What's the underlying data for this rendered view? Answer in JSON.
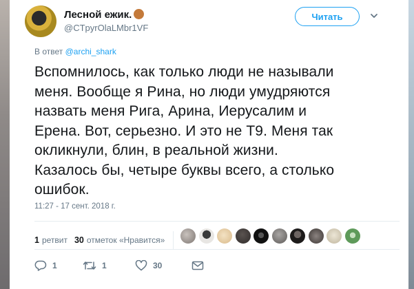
{
  "user": {
    "name": "Лесной ежик.",
    "name_emoji": "hedgehog-emoji",
    "handle": "@CTpyrOlaLMbr1VF",
    "follow_label": "Читать"
  },
  "reply": {
    "prefix": "В ответ",
    "to": "@archi_shark"
  },
  "tweet": {
    "lines": [
      "Вспомнилось, как только люди не называли",
      "меня. Вообще я Рина, но люди умудряются",
      "назвать меня Рига, Арина, Иерусалим и",
      "Ерена. Вот, серьезно. И это не Т9. Меня так",
      "окликнули, блин, в реальной жизни.",
      "Казалось бы, четыре буквы всего, а столько",
      "ошибок."
    ],
    "timestamp": "11:27 - 17 сент. 2018 г."
  },
  "stats": {
    "retweets_count": "1",
    "retweets_label": "ретвит",
    "likes_count": "30",
    "likes_label": "отметок «Нравится»"
  },
  "likers": [
    "avatar-1",
    "avatar-2",
    "avatar-3",
    "avatar-4",
    "avatar-5",
    "avatar-6",
    "avatar-7",
    "avatar-8",
    "avatar-9",
    "avatar-10"
  ],
  "actions": {
    "reply_count": "1",
    "retweet_count": "1",
    "like_count": "30"
  },
  "colors": {
    "accent": "#1da1f2",
    "muted": "#657786",
    "text": "#14171a"
  }
}
